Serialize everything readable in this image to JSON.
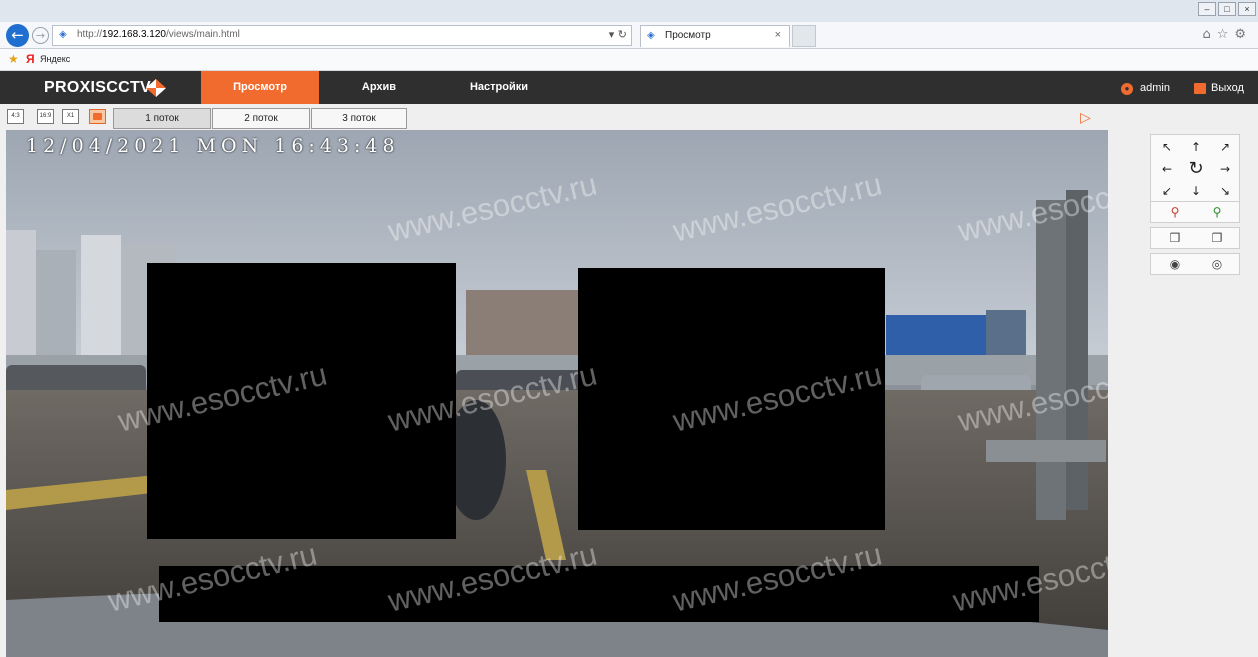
{
  "browser": {
    "url_prefix": "http://",
    "url_host": "192.168.3.120",
    "url_path": "/views/main.html",
    "tab_title": "Просмотр",
    "favorite": "Яндекс"
  },
  "app": {
    "logo": "PROXISCCTV",
    "nav": [
      "Просмотр",
      "Архив",
      "Настройки"
    ],
    "active_nav": "Просмотр",
    "user": "admin",
    "logout": "Выход"
  },
  "toolbar": {
    "ratio_buttons": [
      "4:3",
      "16:9",
      "X1"
    ],
    "streams": [
      "1 поток",
      "2 поток",
      "3 поток"
    ],
    "selected_stream": "1 поток"
  },
  "video": {
    "osd_timestamp": "12/04/2021 MON 16:43:48",
    "watermark": "www.esocctv.ru"
  },
  "ptz": {
    "directions": [
      "up-left",
      "up",
      "up-right",
      "left",
      "reset",
      "right",
      "down-left",
      "down",
      "down-right"
    ],
    "controls": [
      [
        "zoom-out",
        "zoom-in"
      ],
      [
        "focus-near",
        "focus-far"
      ],
      [
        "iris-close",
        "iris-open"
      ]
    ]
  },
  "colors": {
    "accent": "#f26b2e",
    "header": "#2f2f2f",
    "toolbar": "#efefef"
  }
}
